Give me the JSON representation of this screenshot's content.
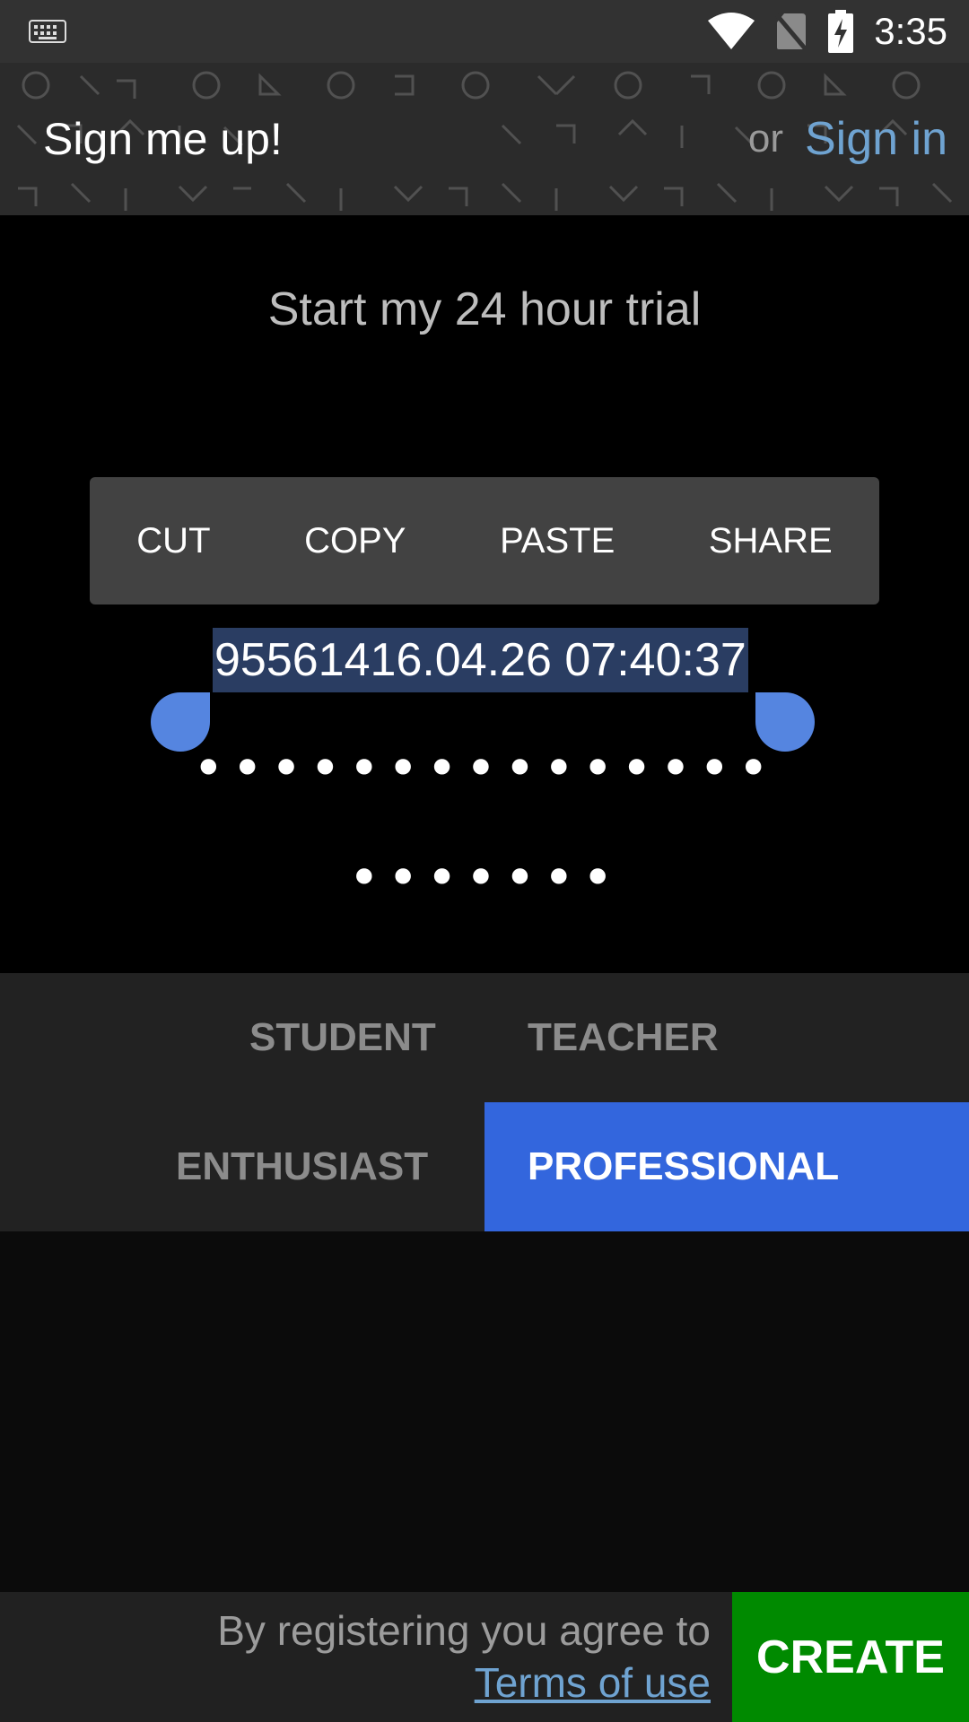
{
  "status_bar": {
    "time": "3:35",
    "icons": [
      "keyboard-icon",
      "wifi-icon",
      "no-sim-icon",
      "battery-charging-icon"
    ]
  },
  "header": {
    "title": "Sign me up!",
    "or_text": "or",
    "signin_label": "Sign in"
  },
  "trial_text": "Start my 24 hour trial",
  "context_menu": {
    "cut": "CUT",
    "copy": "COPY",
    "paste": "PASTE",
    "share": "SHARE"
  },
  "form": {
    "username_value": "95561416.04.26 07:40:37",
    "password_mask": "•••••••••••••••",
    "password_confirm_mask": "•••••••"
  },
  "roles": {
    "student": "STUDENT",
    "teacher": "TEACHER",
    "enthusiast": "ENTHUSIAST",
    "professional": "PROFESSIONAL",
    "selected": "PROFESSIONAL"
  },
  "colors": {
    "accent": "#3366dd",
    "link": "#6fa3d1",
    "create": "#008a00"
  },
  "footer": {
    "agree_text": "By registering you agree to",
    "terms_label": "Terms of use",
    "create_label": "CREATE"
  }
}
